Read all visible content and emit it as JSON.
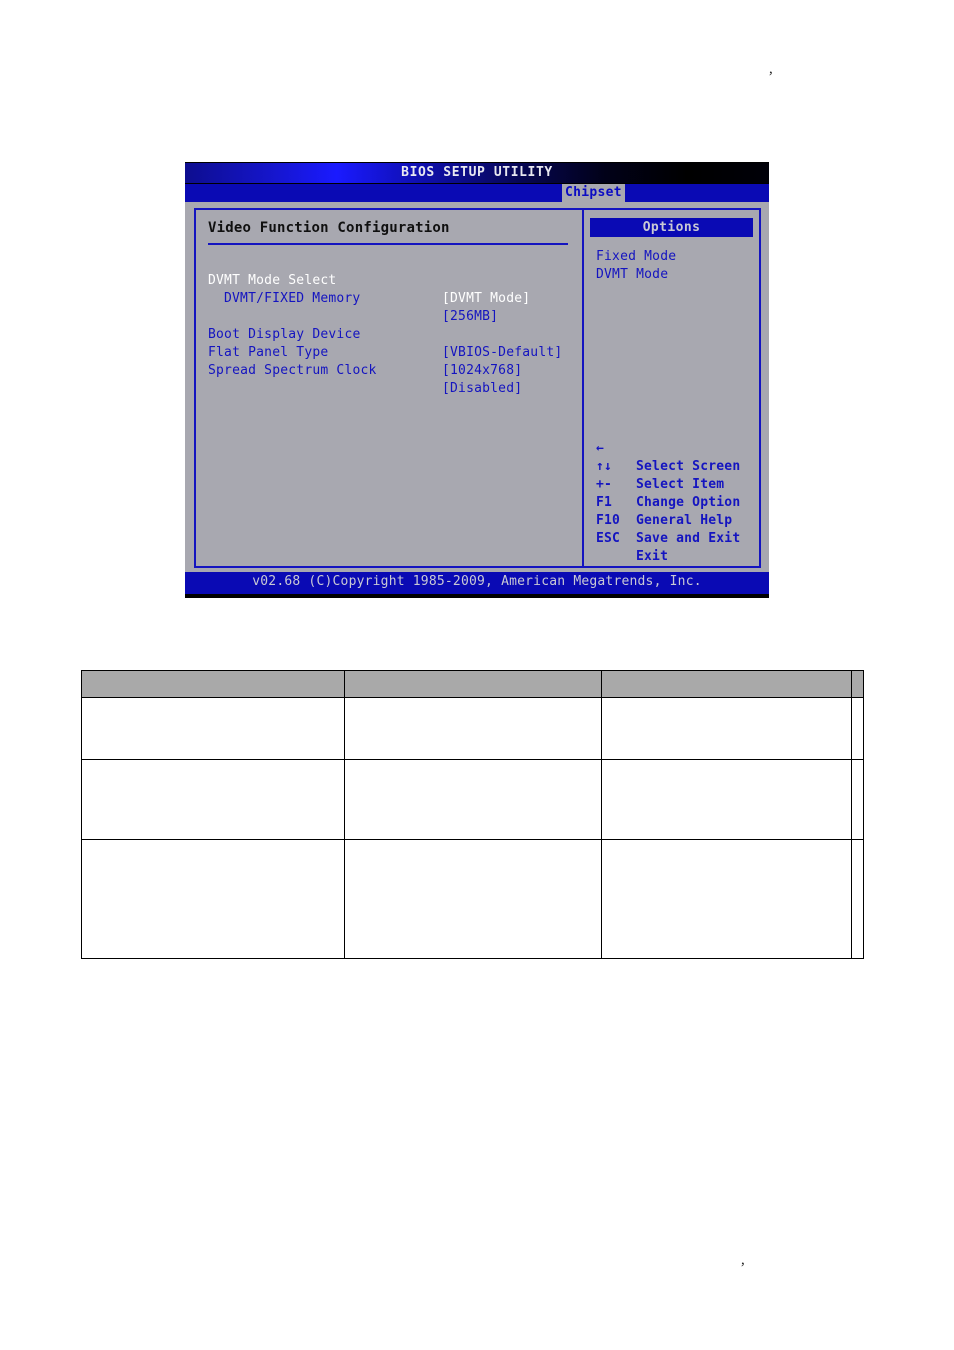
{
  "page": {
    "stray_marks": [
      {
        "name": "stray-comma-top",
        "glyph": ","
      },
      {
        "name": "stray-comma-bottom",
        "glyph": ","
      }
    ]
  },
  "bios": {
    "title": "BIOS SETUP UTILITY",
    "active_tab": "Chipset",
    "tabs": [
      "Chipset"
    ],
    "left_pane": {
      "heading": "Video Function Configuration",
      "settings": [
        {
          "label": "DVMT Mode Select",
          "value": "[DVMT Mode]",
          "indent": false,
          "selected": true
        },
        {
          "label": "DVMT/FIXED Memory",
          "value": "[256MB]",
          "indent": true,
          "selected": false
        },
        {
          "label": "Boot Display Device",
          "value": "[VBIOS-Default]",
          "indent": false,
          "selected": false
        },
        {
          "label": "Flat Panel Type",
          "value": "[1024x768]",
          "indent": false,
          "selected": false
        },
        {
          "label": "Spread Spectrum Clock",
          "value": "[Disabled]",
          "indent": false,
          "selected": false
        }
      ]
    },
    "right_pane": {
      "options_header": "Options",
      "options": [
        "Fixed Mode",
        "DVMT Mode"
      ],
      "key_help": [
        {
          "key": "←",
          "desc": "Select Screen"
        },
        {
          "key": "↑↓",
          "desc": "Select Item"
        },
        {
          "key": "+-",
          "desc": "Change Option"
        },
        {
          "key": "F1",
          "desc": "General Help"
        },
        {
          "key": "F10",
          "desc": "Save and Exit"
        },
        {
          "key": "ESC",
          "desc": "Exit"
        }
      ]
    },
    "footer": "v02.68 (C)Copyright 1985-2009, American Megatrends, Inc.",
    "colors": {
      "panel_bg": "#a8a8b0",
      "accent_blue": "#1414c0",
      "header_blue": "#0a0ab4",
      "selected_text": "#ffffff",
      "heading_text": "#101010",
      "light_text": "#c9c9d4"
    }
  },
  "table": {
    "headers": [
      "",
      "",
      "",
      ""
    ],
    "rows": [
      [
        "",
        "",
        "",
        ""
      ],
      [
        "",
        "",
        "",
        ""
      ],
      [
        "",
        "",
        "",
        ""
      ]
    ],
    "header_bg": "#a9a9a9"
  }
}
